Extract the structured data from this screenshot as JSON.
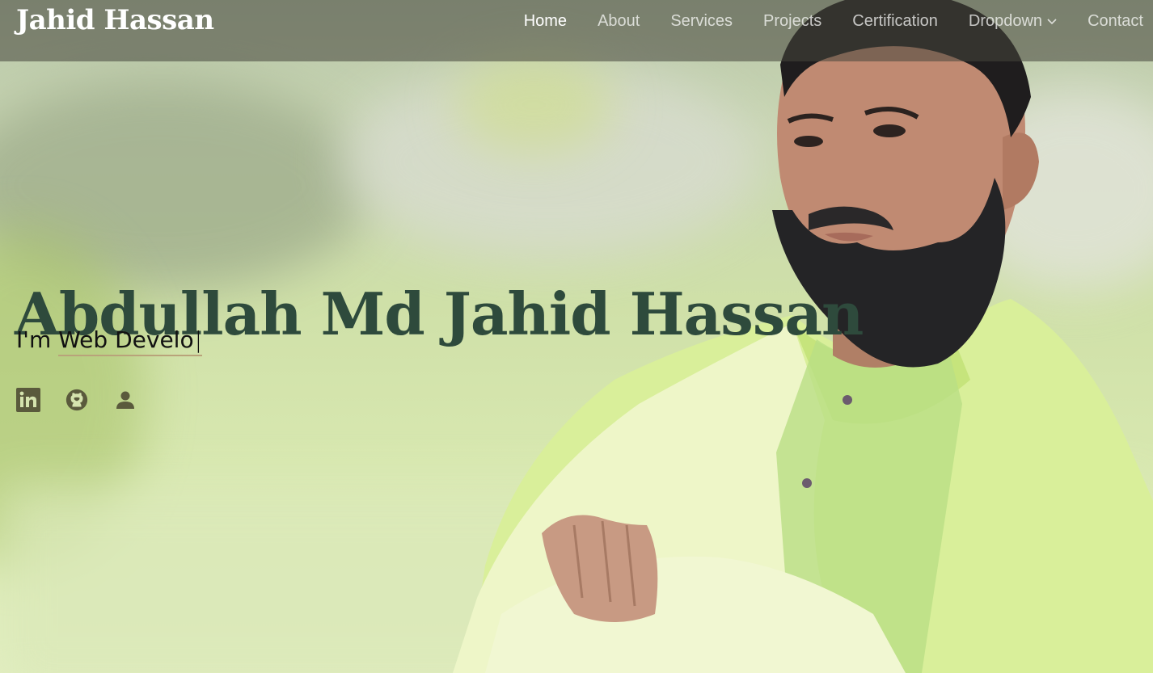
{
  "brand": {
    "logo_text": "Jahid Hassan"
  },
  "nav": {
    "items": [
      {
        "label": "Home",
        "active": true
      },
      {
        "label": "About"
      },
      {
        "label": "Services"
      },
      {
        "label": "Projects"
      },
      {
        "label": "Certification"
      },
      {
        "label": "Dropdown",
        "has_submenu": true,
        "icon": "chevron-down-icon"
      },
      {
        "label": "Contact"
      }
    ]
  },
  "hero": {
    "name": "Abdullah Md Jahid Hassan",
    "typed_prefix": "I'm ",
    "typed_text": "Web Develo",
    "cursor": "|"
  },
  "socials": [
    {
      "icon": "linkedin-icon"
    },
    {
      "icon": "github-icon"
    },
    {
      "icon": "person-icon"
    }
  ],
  "colors": {
    "name_text": "#2e4a3c",
    "underline": "#b9a37a",
    "social_icon": "#5a5a3c",
    "nav_bg": "rgba(70,70,60,0.55)"
  }
}
